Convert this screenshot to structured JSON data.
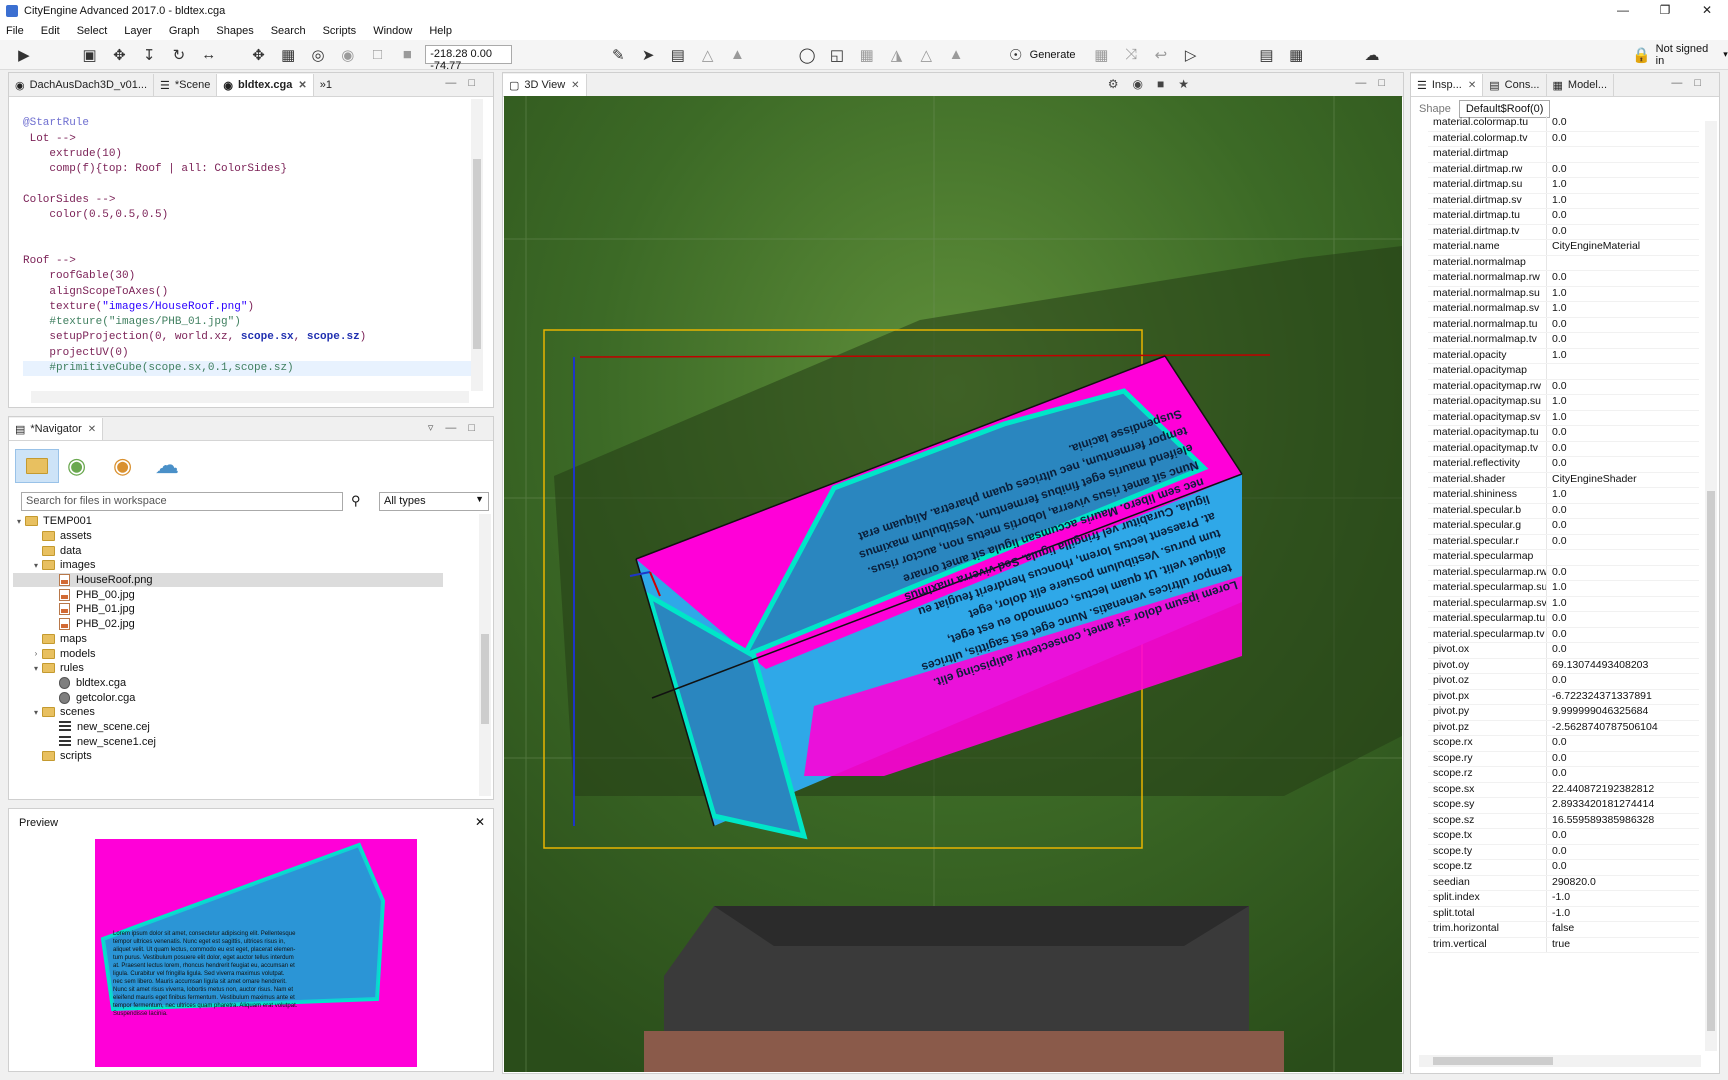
{
  "window": {
    "title": "CityEngine Advanced 2017.0 - bldtex.cga"
  },
  "menu": [
    "File",
    "Edit",
    "Select",
    "Layer",
    "Graph",
    "Shapes",
    "Search",
    "Scripts",
    "Window",
    "Help"
  ],
  "toolbar": {
    "coords": "-218.28 0.00 -74.77",
    "generate_label": "Generate",
    "signin_label": "Not signed in"
  },
  "editor": {
    "tabs": [
      {
        "label": "DachAusDach3D_v01..."
      },
      {
        "label": "*Scene"
      },
      {
        "label": "bldtex.cga"
      },
      {
        "label": "»1"
      }
    ],
    "lines": [
      [],
      [
        {
          "t": "@StartRule",
          "c": "c-rule"
        }
      ],
      [
        {
          "t": " Lot -->",
          "c": "c-kw"
        }
      ],
      [
        {
          "t": "    extrude(10)",
          "c": "c-kw"
        }
      ],
      [
        {
          "t": "    comp(f){top: Roof | all: ColorSides}",
          "c": "c-kw"
        }
      ],
      [],
      [
        {
          "t": "ColorSides -->",
          "c": "c-kw"
        }
      ],
      [
        {
          "t": "    color(0.5,0.5,0.5)",
          "c": "c-kw"
        }
      ],
      [],
      [],
      [
        {
          "t": "Roof -->",
          "c": "c-kw"
        }
      ],
      [
        {
          "t": "    roofGable(30)",
          "c": "c-kw"
        }
      ],
      [
        {
          "t": "    alignScopeToAxes()",
          "c": "c-kw"
        }
      ],
      [
        {
          "t": "    texture(",
          "c": "c-kw"
        },
        {
          "t": "\"images/HouseRoof.png\"",
          "c": "c-str"
        },
        {
          "t": ")",
          "c": "c-kw"
        }
      ],
      [
        {
          "t": "    #texture(\"images/PHB_01.jpg\")",
          "c": "c-com"
        }
      ],
      [
        {
          "t": "    setupProjection(0, world.xz, ",
          "c": "c-kw"
        },
        {
          "t": "scope.sx",
          "c": "c-bold"
        },
        {
          "t": ", ",
          "c": "c-kw"
        },
        {
          "t": "scope.sz",
          "c": "c-bold"
        },
        {
          "t": ")",
          "c": "c-kw"
        }
      ],
      [
        {
          "t": "    projectUV(0)",
          "c": "c-kw"
        }
      ],
      [
        {
          "t": "    #primitiveCube(scope.sx,0.1,scope.sz)",
          "c": "c-com"
        }
      ]
    ]
  },
  "navigator": {
    "tab_label": "*Navigator",
    "search_placeholder": "Search for files in workspace",
    "type_filter": "All types",
    "tree": [
      {
        "label": "TEMP001",
        "kind": "folder",
        "depth": 0,
        "arrow": "▾"
      },
      {
        "label": "assets",
        "kind": "folder",
        "depth": 1,
        "arrow": ""
      },
      {
        "label": "data",
        "kind": "folder",
        "depth": 1,
        "arrow": ""
      },
      {
        "label": "images",
        "kind": "folder",
        "depth": 1,
        "arrow": "▾"
      },
      {
        "label": "HouseRoof.png",
        "kind": "img",
        "depth": 2,
        "arrow": "",
        "selected": true
      },
      {
        "label": "PHB_00.jpg",
        "kind": "img",
        "depth": 2,
        "arrow": ""
      },
      {
        "label": "PHB_01.jpg",
        "kind": "img",
        "depth": 2,
        "arrow": ""
      },
      {
        "label": "PHB_02.jpg",
        "kind": "img",
        "depth": 2,
        "arrow": ""
      },
      {
        "label": "maps",
        "kind": "folder",
        "depth": 1,
        "arrow": ""
      },
      {
        "label": "models",
        "kind": "folder",
        "depth": 1,
        "arrow": "›"
      },
      {
        "label": "rules",
        "kind": "folder",
        "depth": 1,
        "arrow": "▾"
      },
      {
        "label": "bldtex.cga",
        "kind": "cga",
        "depth": 2,
        "arrow": ""
      },
      {
        "label": "getcolor.cga",
        "kind": "cga",
        "depth": 2,
        "arrow": ""
      },
      {
        "label": "scenes",
        "kind": "folder",
        "depth": 1,
        "arrow": "▾"
      },
      {
        "label": "new_scene.cej",
        "kind": "cej",
        "depth": 2,
        "arrow": ""
      },
      {
        "label": "new_scene1.cej",
        "kind": "cej",
        "depth": 2,
        "arrow": ""
      },
      {
        "label": "scripts",
        "kind": "folder",
        "depth": 1,
        "arrow": ""
      }
    ]
  },
  "preview": {
    "title": "Preview"
  },
  "view3d": {
    "tab_label": "3D View"
  },
  "inspector": {
    "tabs": [
      {
        "label": "Insp..."
      },
      {
        "label": "Cons..."
      },
      {
        "label": "Model..."
      }
    ],
    "shape_label": "Shape",
    "rule_label": "Default$Roof(0)",
    "rows": [
      [
        "material.colormap.tu",
        "0.0"
      ],
      [
        "material.colormap.tv",
        "0.0"
      ],
      [
        "material.dirtmap",
        ""
      ],
      [
        "material.dirtmap.rw",
        "0.0"
      ],
      [
        "material.dirtmap.su",
        "1.0"
      ],
      [
        "material.dirtmap.sv",
        "1.0"
      ],
      [
        "material.dirtmap.tu",
        "0.0"
      ],
      [
        "material.dirtmap.tv",
        "0.0"
      ],
      [
        "material.name",
        "CityEngineMaterial"
      ],
      [
        "material.normalmap",
        ""
      ],
      [
        "material.normalmap.rw",
        "0.0"
      ],
      [
        "material.normalmap.su",
        "1.0"
      ],
      [
        "material.normalmap.sv",
        "1.0"
      ],
      [
        "material.normalmap.tu",
        "0.0"
      ],
      [
        "material.normalmap.tv",
        "0.0"
      ],
      [
        "material.opacity",
        "1.0"
      ],
      [
        "material.opacitymap",
        ""
      ],
      [
        "material.opacitymap.rw",
        "0.0"
      ],
      [
        "material.opacitymap.su",
        "1.0"
      ],
      [
        "material.opacitymap.sv",
        "1.0"
      ],
      [
        "material.opacitymap.tu",
        "0.0"
      ],
      [
        "material.opacitymap.tv",
        "0.0"
      ],
      [
        "material.reflectivity",
        "0.0"
      ],
      [
        "material.shader",
        "CityEngineShader"
      ],
      [
        "material.shininess",
        "1.0"
      ],
      [
        "material.specular.b",
        "0.0"
      ],
      [
        "material.specular.g",
        "0.0"
      ],
      [
        "material.specular.r",
        "0.0"
      ],
      [
        "material.specularmap",
        ""
      ],
      [
        "material.specularmap.rw",
        "0.0"
      ],
      [
        "material.specularmap.su",
        "1.0"
      ],
      [
        "material.specularmap.sv",
        "1.0"
      ],
      [
        "material.specularmap.tu",
        "0.0"
      ],
      [
        "material.specularmap.tv",
        "0.0"
      ],
      [
        "pivot.ox",
        "0.0"
      ],
      [
        "pivot.oy",
        "69.13074493408203"
      ],
      [
        "pivot.oz",
        "0.0"
      ],
      [
        "pivot.px",
        "-6.722324371337891"
      ],
      [
        "pivot.py",
        "9.999999046325684"
      ],
      [
        "pivot.pz",
        "-2.5628740787506104"
      ],
      [
        "scope.rx",
        "0.0"
      ],
      [
        "scope.ry",
        "0.0"
      ],
      [
        "scope.rz",
        "0.0"
      ],
      [
        "scope.sx",
        "22.440872192382812"
      ],
      [
        "scope.sy",
        "2.8933420181274414"
      ],
      [
        "scope.sz",
        "16.559589385986328"
      ],
      [
        "scope.tx",
        "0.0"
      ],
      [
        "scope.ty",
        "0.0"
      ],
      [
        "scope.tz",
        "0.0"
      ],
      [
        "seedian",
        "290820.0"
      ],
      [
        "split.index",
        "-1.0"
      ],
      [
        "split.total",
        "-1.0"
      ],
      [
        "trim.horizontal",
        "false"
      ],
      [
        "trim.vertical",
        "true"
      ]
    ]
  },
  "colors": {
    "magenta": "#ff00d8",
    "blue": "#2fa8e8",
    "cyan": "#00e6c8",
    "bbox": "#e8b400"
  }
}
